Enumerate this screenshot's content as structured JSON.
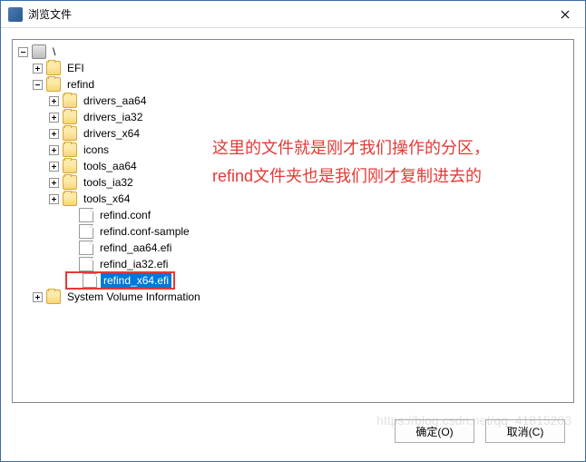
{
  "window": {
    "title": "浏览文件"
  },
  "tree": {
    "root": "\\",
    "efi": "EFI",
    "refind": "refind",
    "drivers_aa64": "drivers_aa64",
    "drivers_ia32": "drivers_ia32",
    "drivers_x64": "drivers_x64",
    "icons": "icons",
    "tools_aa64": "tools_aa64",
    "tools_ia32": "tools_ia32",
    "tools_x64": "tools_x64",
    "refind_conf": "refind.conf",
    "refind_conf_sample": "refind.conf-sample",
    "refind_aa64_efi": "refind_aa64.efi",
    "refind_ia32_efi": "refind_ia32.efi",
    "refind_x64_efi": "refind_x64.efi",
    "svi": "System Volume Information"
  },
  "annotation": {
    "line1": "这里的文件就是刚才我们操作的分区，",
    "line2": "refind文件夹也是我们刚才复制进去的"
  },
  "buttons": {
    "ok": "确定(O)",
    "cancel": "取消(C)"
  },
  "watermark": "https://blog.csdn.net/qq_41815203"
}
